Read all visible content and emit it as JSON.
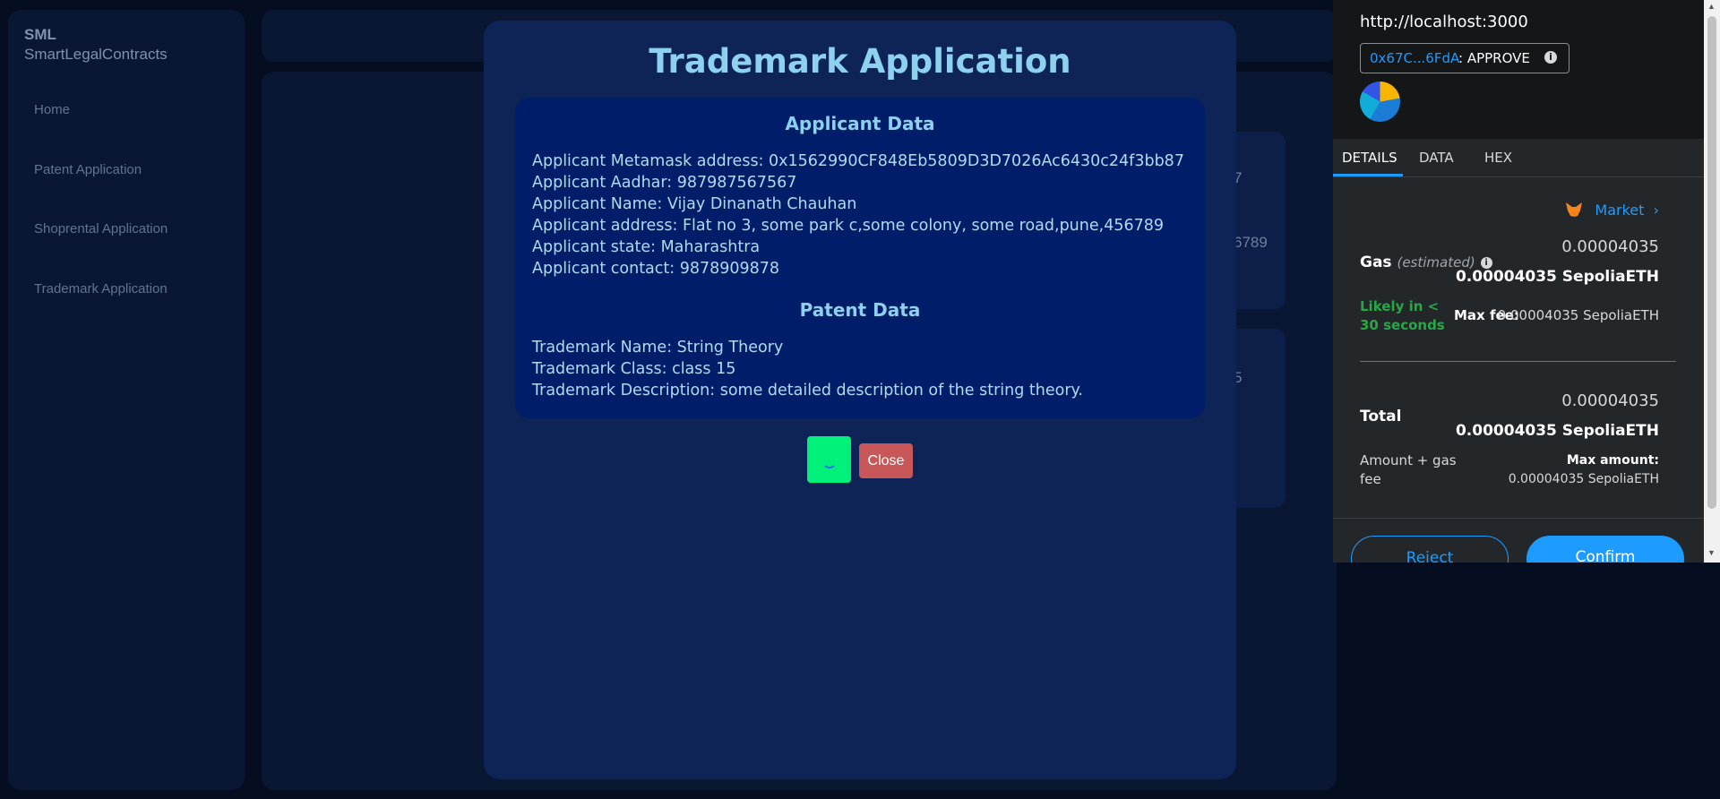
{
  "sidebar": {
    "brand_short": "SML",
    "brand_full": "SmartLegalContracts",
    "items": [
      {
        "label": "Home"
      },
      {
        "label": "Patent Application"
      },
      {
        "label": "Shoprental Application"
      },
      {
        "label": "Trademark Application"
      }
    ]
  },
  "background_fragments": [
    "7",
    "6789",
    "5"
  ],
  "modal": {
    "title": "Trademark Application",
    "applicant_heading": "Applicant Data",
    "applicant_lines": [
      "Applicant Metamask address: 0x1562990CF848Eb5809D3D7026Ac6430c24f3bb87",
      "Applicant Aadhar: 987987567567",
      "Applicant Name: Vijay Dinanath Chauhan",
      "Applicant address: Flat no 3, some park c,some colony, some road,pune,456789",
      "Applicant state: Maharashtra",
      "Applicant contact: 9878909878"
    ],
    "patent_heading": "Patent Data",
    "patent_lines": [
      "Trademark Name: String Theory",
      "Trademark Class: class 15",
      "Trademark Description: some detailed description of the string theory."
    ],
    "close_label": "Close"
  },
  "metamask": {
    "origin": "http://localhost:3000",
    "account_short": "0x67C...6FdA",
    "action": ": APPROVE",
    "tabs": [
      "DETAILS",
      "DATA",
      "HEX"
    ],
    "market_label": "Market",
    "gas_label": "Gas",
    "gas_sub": "(estimated)",
    "gas_value": "0.00004035",
    "gas_value_eth": "0.00004035 SepoliaETH",
    "likely_label": "Likely in < 30 seconds",
    "max_fee_label": "Max fee:",
    "max_fee_value": "0.00004035 SepoliaETH",
    "total_label": "Total",
    "total_value": "0.00004035",
    "total_value_eth": "0.00004035 SepoliaETH",
    "amount_gas_label": "Amount + gas fee",
    "max_amount_label": "Max amount:",
    "max_amount_value": "0.00004035 SepoliaETH",
    "reject_label": "Reject",
    "confirm_label": "Confirm"
  },
  "colors": {
    "modal_bg": "#0e2457",
    "accent_title": "#8ed1ef",
    "submit_green": "#00f07a",
    "close_red": "#c8575a",
    "metamask_blue": "#1e9bff",
    "likely_green": "#28a745"
  }
}
